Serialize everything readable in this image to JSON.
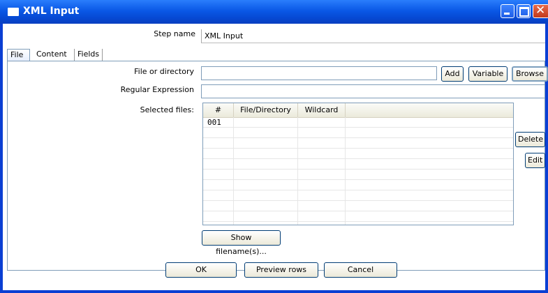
{
  "window": {
    "title": "XML Input",
    "icons": {
      "app": "window-icon",
      "minimize": "minimize-icon",
      "maximize": "maximize-icon",
      "close": "close-icon"
    },
    "colors": {
      "titlebar": "#0a58e6",
      "close": "#c2391b"
    }
  },
  "step": {
    "label": "Step name",
    "value": "XML Input"
  },
  "tabs": [
    {
      "label": "File",
      "active": true
    },
    {
      "label": "Content"
    },
    {
      "label": "Fields"
    }
  ],
  "file": {
    "file_or_directory_label": "File or directory",
    "file_or_directory_value": "",
    "regex_label": "Regular Expression",
    "regex_value": "",
    "selected_files_label": "Selected files:",
    "add_button": "Add",
    "variable_button": "Variable",
    "browse_button": "Browse",
    "delete_button": "Delete",
    "edit_button": "Edit",
    "show_filenames_button": "Show filename(s)..."
  },
  "table": {
    "columns": [
      "#",
      "File/Directory",
      "Wildcard"
    ],
    "rows": [
      [
        "001",
        "",
        ""
      ]
    ]
  },
  "footer": {
    "ok": "OK",
    "preview": "Preview rows",
    "cancel": "Cancel"
  }
}
